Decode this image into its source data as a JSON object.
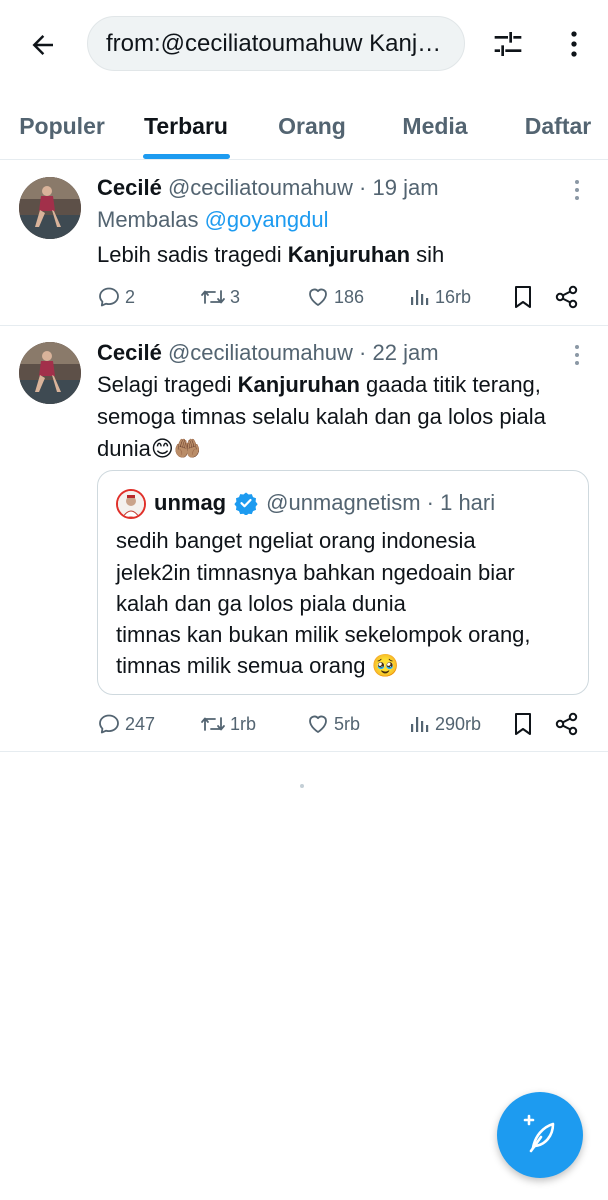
{
  "search": {
    "query": "from:@ceciliatoumahuw Kanjuruhan"
  },
  "tabs": [
    {
      "label": "Populer"
    },
    {
      "label": "Terbaru"
    },
    {
      "label": "Orang"
    },
    {
      "label": "Media"
    },
    {
      "label": "Daftar"
    }
  ],
  "active_tab": "Terbaru",
  "tweets": [
    {
      "name": "Cecilé",
      "handle": "@ceciliatoumahuw",
      "sep": " · ",
      "time": "19 jam",
      "reply_prefix": "Membalas ",
      "reply_to": "@goyangdul",
      "text_before": "Lebih sadis tragedi ",
      "text_bold": "Kanjuruhan",
      "text_after": " sih",
      "replies": "2",
      "retweets": "3",
      "likes": "186",
      "views": "16rb"
    },
    {
      "name": "Cecilé",
      "handle": "@ceciliatoumahuw",
      "sep": " · ",
      "time": "22 jam",
      "line1_before": "Selagi tragedi ",
      "line1_bold": "Kanjuruhan",
      "line1_after": " gaada titik terang,",
      "line2": "semoga timnas selalu kalah dan ga lolos piala",
      "line3": "dunia😊🤲🏽",
      "quote": {
        "name": "unmag",
        "handle": "@unmagnetism",
        "sep": " · ",
        "time": "1 hari",
        "lines": [
          "sedih banget ngeliat orang indonesia",
          "jelek2in timnasnya bahkan ngedoain biar",
          "kalah dan ga lolos piala dunia",
          "timnas kan bukan milik sekelompok orang,",
          "timnas milik semua orang 🥹"
        ]
      },
      "replies": "247",
      "retweets": "1rb",
      "likes": "5rb",
      "views": "290rb"
    }
  ],
  "icons": {
    "back": "arrow-left-icon",
    "filter": "sliders-icon",
    "more": "more-vertical-icon",
    "compose": "feather-plus-icon",
    "verified": "verified-badge-icon"
  },
  "colors": {
    "accent": "#1d9bf0",
    "text": "#0f1419",
    "muted": "#536471"
  }
}
